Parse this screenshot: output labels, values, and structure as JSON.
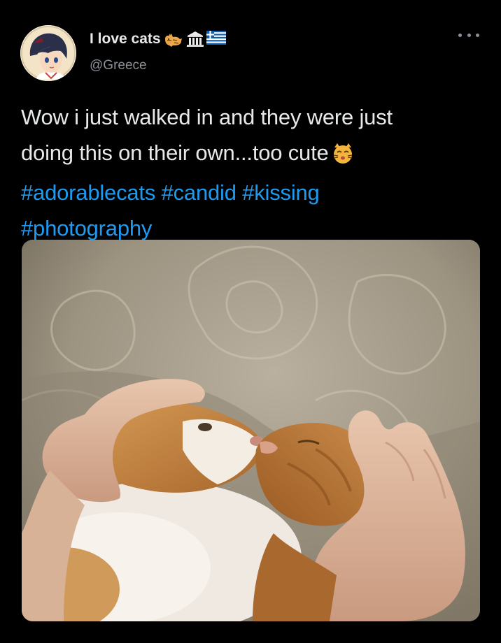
{
  "user": {
    "display_name": "I love cats",
    "handle": "@Greece",
    "name_emojis": [
      "cat-emoji",
      "classical-building-emoji",
      "greek-flag-emoji"
    ],
    "avatar": "anime-character-avatar"
  },
  "tweet": {
    "text_lines": [
      "Wow i just walked in and they were just",
      "doing this on their own...too cute"
    ],
    "text_emoji": "kissing-cat-emoji",
    "hashtags": [
      "#adorablecats",
      "#candid",
      "#kissing",
      "#photography"
    ]
  },
  "media": {
    "subject": "two-cats-kissing-photo"
  },
  "colors": {
    "background": "#000000",
    "text": "#e7e9ea",
    "secondary": "#8b9197",
    "link": "#1d9bf0"
  }
}
